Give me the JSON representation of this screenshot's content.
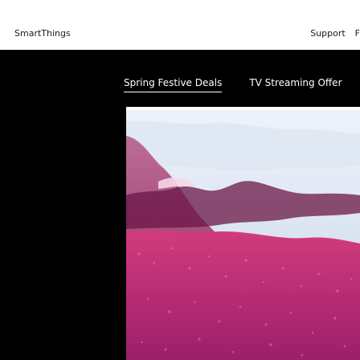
{
  "nav": {
    "brand": "SmartThings",
    "links": [
      "Support",
      "F"
    ]
  },
  "promo_tabs": [
    {
      "label": "Spring Festive Deals",
      "active": true
    },
    {
      "label": "TV Streaming Offer",
      "active": false
    }
  ],
  "colors": {
    "promo_background": "#000000",
    "sky": "#c8d6e8",
    "flower_field": "#9c1f6a"
  },
  "banner": {
    "icon": "spring-flower-field-image"
  }
}
